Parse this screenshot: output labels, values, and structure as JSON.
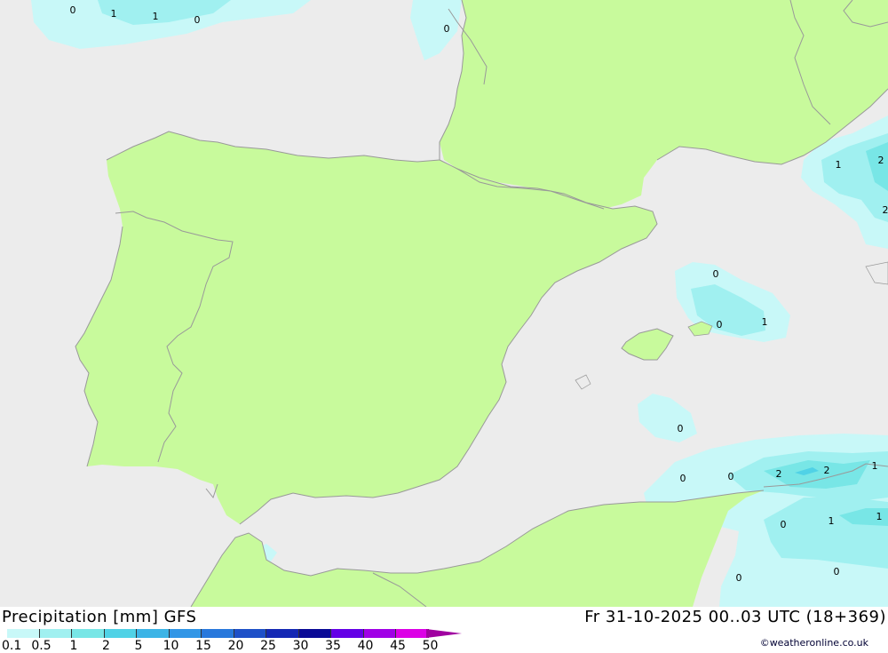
{
  "header": {
    "title": "Precipitation [mm] GFS",
    "datetime": "Fr 31-10-2025 00..03 UTC (18+369)",
    "credit": "©weatheronline.co.uk"
  },
  "legend": {
    "items": [
      {
        "label": "0.1",
        "color": "#c8f8f8"
      },
      {
        "label": "0.5",
        "color": "#a0f0f0"
      },
      {
        "label": "1",
        "color": "#78e6e6"
      },
      {
        "label": "2",
        "color": "#50d2e6"
      },
      {
        "label": "5",
        "color": "#3cb4e6"
      },
      {
        "label": "10",
        "color": "#3296e6"
      },
      {
        "label": "15",
        "color": "#2878dc"
      },
      {
        "label": "20",
        "color": "#1e50c8"
      },
      {
        "label": "25",
        "color": "#1428b4"
      },
      {
        "label": "30",
        "color": "#0a0a96"
      },
      {
        "label": "35",
        "color": "#6400e6"
      },
      {
        "label": "40",
        "color": "#a000e6"
      },
      {
        "label": "45",
        "color": "#dc00e6"
      },
      {
        "label": "50",
        "color": "#c800c8"
      }
    ],
    "arrow_color": "#a000a0"
  },
  "map": {
    "sea_color": "#ececec",
    "land_color": "#c8fa9c",
    "border_color": "#999999",
    "labels": [
      "0",
      "1",
      "1",
      "0",
      "0",
      "1",
      "2",
      "2",
      "0",
      "0",
      "1",
      "0",
      "0",
      "0",
      "2",
      "2",
      "1",
      "0",
      "1",
      "1",
      "0",
      "0"
    ]
  }
}
